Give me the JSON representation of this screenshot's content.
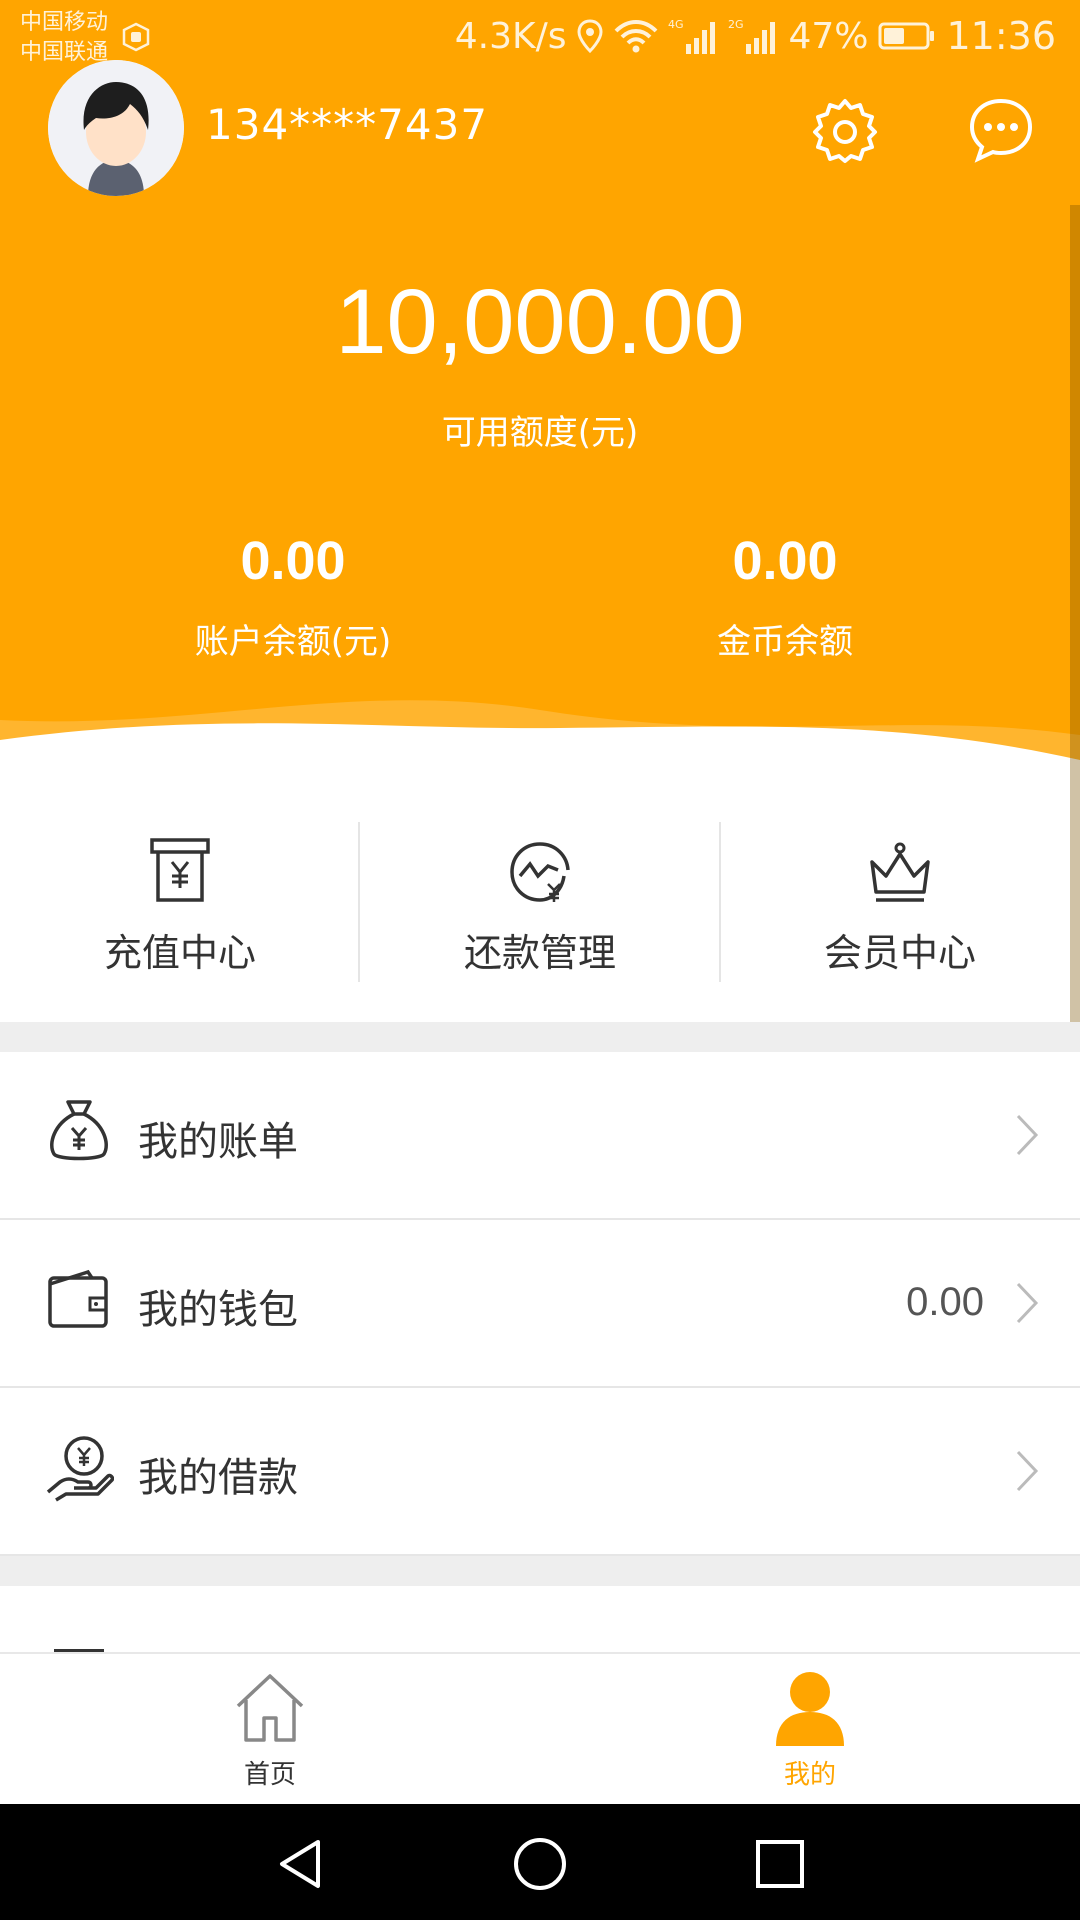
{
  "status_bar": {
    "carrier_1": "中国移动",
    "carrier_2": "中国联通",
    "net_speed": "4.3K/s",
    "network_1": "4G",
    "network_2": "2G",
    "battery_percent": "47%",
    "time": "11:36"
  },
  "profile": {
    "phone": "134****7437"
  },
  "summary": {
    "available_amount": "10,000.00",
    "available_label": "可用额度(元)",
    "account_balance": "0.00",
    "account_balance_label": "账户余额(元)",
    "coin_balance": "0.00",
    "coin_balance_label": "金币余额"
  },
  "quick_actions": [
    {
      "label": "充值中心",
      "icon": "recharge-icon"
    },
    {
      "label": "还款管理",
      "icon": "repayment-icon"
    },
    {
      "label": "会员中心",
      "icon": "crown-icon"
    }
  ],
  "menu": [
    {
      "label": "我的账单",
      "icon": "money-bag-icon",
      "value": ""
    },
    {
      "label": "我的钱包",
      "icon": "wallet-icon",
      "value": "0.00"
    },
    {
      "label": "我的借款",
      "icon": "loan-hand-icon",
      "value": ""
    }
  ],
  "tabbar": {
    "home_label": "首页",
    "mine_label": "我的",
    "active": "我的"
  },
  "colors": {
    "accent": "#FFA500",
    "background": "#FFFFFF",
    "divider": "#EEEEEE"
  }
}
